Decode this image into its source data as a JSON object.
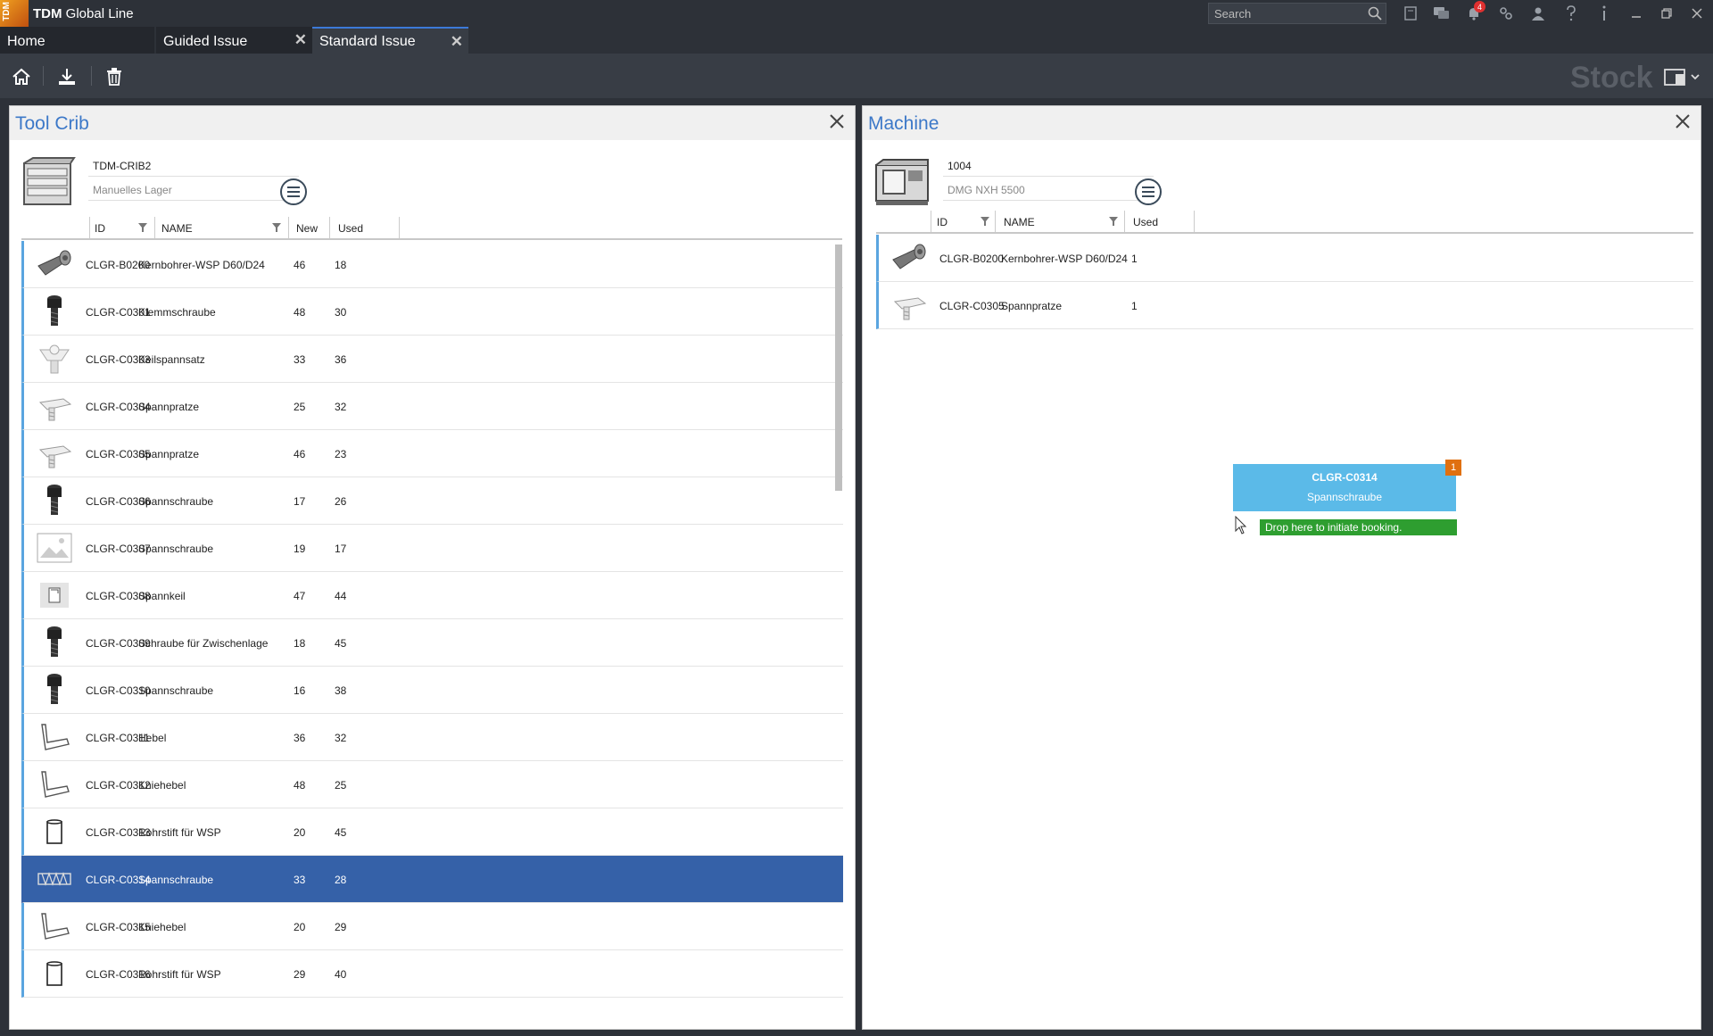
{
  "app": {
    "title_bold": "TDM",
    "title_rest": "Global Line",
    "logo_text": "TDM",
    "search_placeholder": "Search",
    "notification_count": "4"
  },
  "tabs": [
    {
      "label": "Home",
      "closable": false,
      "active": false
    },
    {
      "label": "Guided Issue",
      "closable": true,
      "active": false
    },
    {
      "label": "Standard Issue",
      "closable": true,
      "active": true
    }
  ],
  "toolbar": {
    "mode_label": "Stock",
    "icons": [
      "home-icon",
      "download-icon",
      "trash-icon"
    ]
  },
  "tool_crib": {
    "title": "Tool Crib",
    "location_id": "TDM-CRIB2",
    "location_name": "Manuelles Lager",
    "columns": {
      "id": "ID",
      "name": "NAME",
      "new": "New",
      "used": "Used"
    },
    "rows": [
      {
        "id": "CLGR-B0200",
        "name": "Kernbohrer-WSP D60/D24",
        "new": "46",
        "used": "18",
        "thumb": "drill"
      },
      {
        "id": "CLGR-C0301",
        "name": "Klemmschraube",
        "new": "48",
        "used": "30",
        "thumb": "screw"
      },
      {
        "id": "CLGR-C0303",
        "name": "Keilspannsatz",
        "new": "33",
        "used": "36",
        "thumb": "wedge"
      },
      {
        "id": "CLGR-C0304",
        "name": "Spannpratze",
        "new": "25",
        "used": "32",
        "thumb": "clamp"
      },
      {
        "id": "CLGR-C0305",
        "name": "Spannpratze",
        "new": "46",
        "used": "23",
        "thumb": "clamp"
      },
      {
        "id": "CLGR-C0306",
        "name": "Spannschraube",
        "new": "17",
        "used": "26",
        "thumb": "screw"
      },
      {
        "id": "CLGR-C0307",
        "name": "Spannschraube",
        "new": "19",
        "used": "17",
        "thumb": "image"
      },
      {
        "id": "CLGR-C0308",
        "name": "Spannkeil",
        "new": "47",
        "used": "44",
        "thumb": "keil"
      },
      {
        "id": "CLGR-C0309",
        "name": "Schraube für Zwischenlage",
        "new": "18",
        "used": "45",
        "thumb": "screw"
      },
      {
        "id": "CLGR-C0310",
        "name": "Spannschraube",
        "new": "16",
        "used": "38",
        "thumb": "screw"
      },
      {
        "id": "CLGR-C0311",
        "name": "Hebel",
        "new": "36",
        "used": "32",
        "thumb": "lever"
      },
      {
        "id": "CLGR-C0312",
        "name": "Kniehebel",
        "new": "48",
        "used": "25",
        "thumb": "lever"
      },
      {
        "id": "CLGR-C0313",
        "name": "Rohrstift für WSP",
        "new": "20",
        "used": "45",
        "thumb": "pin"
      },
      {
        "id": "CLGR-C0314",
        "name": "Spannschraube",
        "new": "33",
        "used": "28",
        "thumb": "spring",
        "selected": true
      },
      {
        "id": "CLGR-C0315",
        "name": "Kniehebel",
        "new": "20",
        "used": "29",
        "thumb": "lever"
      },
      {
        "id": "CLGR-C0316",
        "name": "Rohrstift für WSP",
        "new": "29",
        "used": "40",
        "thumb": "pin"
      }
    ]
  },
  "machine": {
    "title": "Machine",
    "machine_id": "1004",
    "machine_name": "DMG NXH 5500",
    "columns": {
      "id": "ID",
      "name": "NAME",
      "used": "Used"
    },
    "rows": [
      {
        "id": "CLGR-B0200",
        "name": "Kernbohrer-WSP D60/D24",
        "used": "1",
        "thumb": "drill"
      },
      {
        "id": "CLGR-C0305",
        "name": "Spannpratze",
        "used": "1",
        "thumb": "clamp"
      }
    ]
  },
  "drag": {
    "id": "CLGR-C0314",
    "name": "Spannschraube",
    "count": "1",
    "hint": "Drop here to initiate booking."
  }
}
